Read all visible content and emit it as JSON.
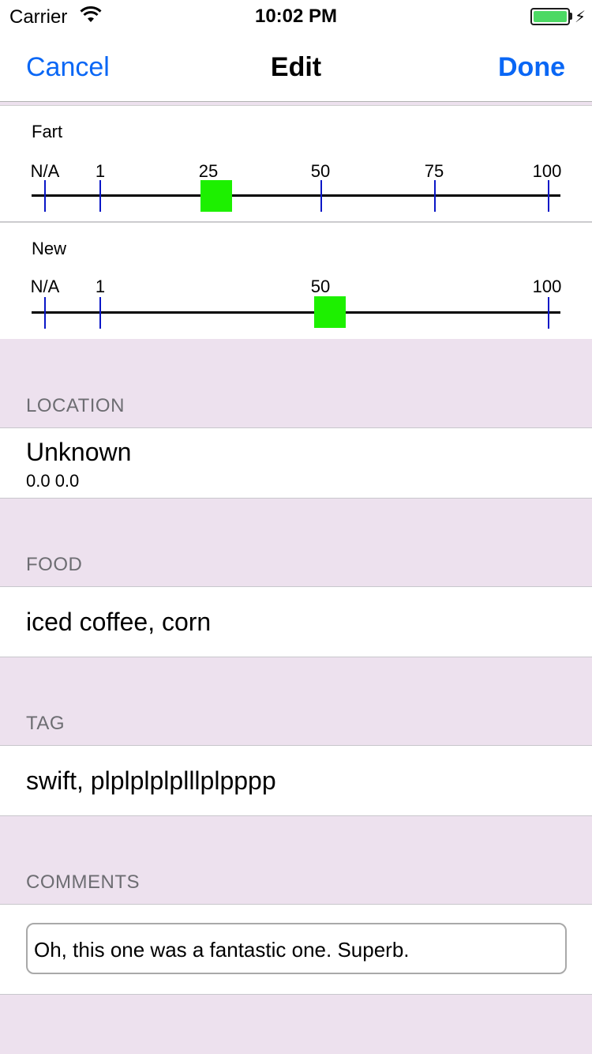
{
  "status": {
    "carrier": "Carrier",
    "time": "10:02 PM",
    "battery_color": "#4cd964"
  },
  "nav": {
    "cancel": "Cancel",
    "title": "Edit",
    "done": "Done",
    "accent": "#0a67f5"
  },
  "sliders": [
    {
      "label": "Fart",
      "ticks": [
        "N/A",
        "1",
        "25",
        "50",
        "75",
        "100"
      ],
      "value": 25,
      "thumb_color": "#1df000"
    },
    {
      "label": "New",
      "ticks": [
        "N/A",
        "1",
        "50",
        "100"
      ],
      "value": 50,
      "thumb_color": "#1df000"
    }
  ],
  "location": {
    "header": "LOCATION",
    "name": "Unknown",
    "coords": "0.0 0.0"
  },
  "food": {
    "header": "FOOD",
    "value": "iced coffee, corn"
  },
  "tag": {
    "header": "TAG",
    "value": "swift, plplplplplllplpppp"
  },
  "comments": {
    "header": "COMMENTS",
    "value": "Oh, this one was a fantastic one. Superb."
  }
}
